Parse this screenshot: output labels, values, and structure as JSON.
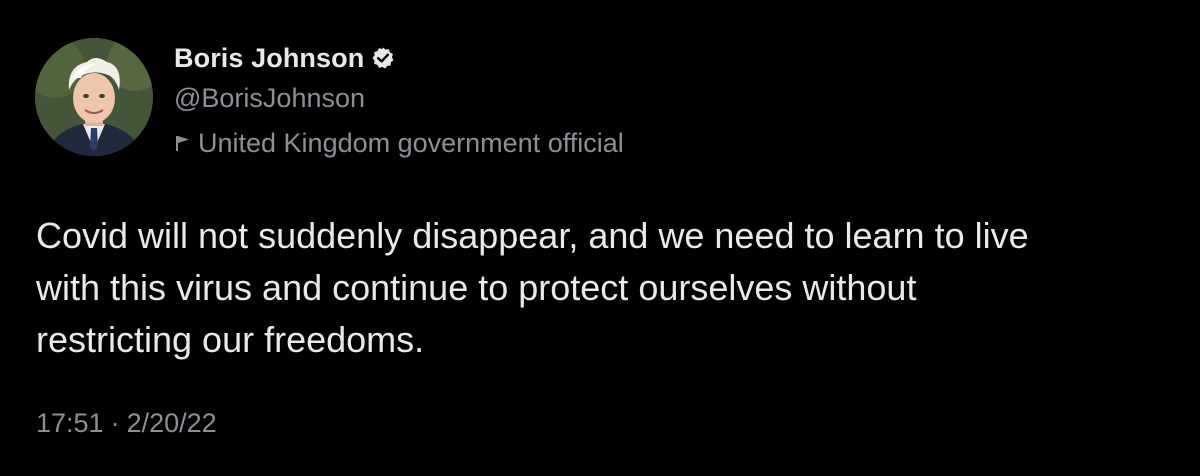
{
  "author": {
    "display_name": "Boris Johnson",
    "handle": "@BorisJohnson",
    "affiliation": "United Kingdom government official",
    "verified": true
  },
  "tweet": {
    "text_lines": [
      "Covid will not suddenly disappear, and we need to learn to live",
      "with this virus and continue to protect ourselves without",
      "restricting our freedoms."
    ],
    "time": "17:51",
    "separator": "·",
    "date": "2/20/22"
  },
  "colors": {
    "background": "#000000",
    "primary_text": "#e7e9ea",
    "secondary_text": "#8b9096"
  },
  "icons": {
    "verified": "verified-badge-icon",
    "affiliation": "flag-icon"
  }
}
